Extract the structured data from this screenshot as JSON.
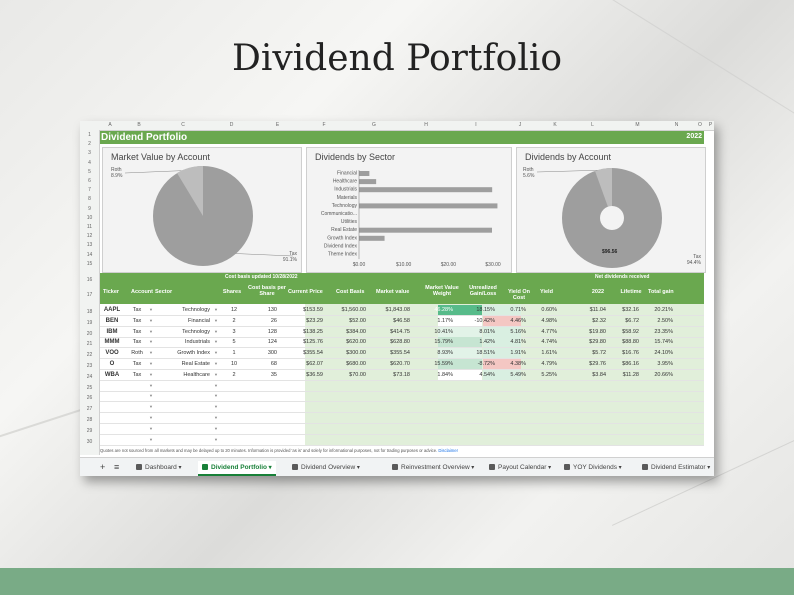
{
  "headline": "Dividend Portfolio",
  "sheet": {
    "col_letters": [
      "A",
      "B",
      "C",
      "D",
      "E",
      "F",
      "G",
      "H",
      "I",
      "J",
      "K",
      "L",
      "M",
      "N",
      "O",
      "P"
    ],
    "row_numbers": [
      "1",
      "2",
      "3",
      "4",
      "5",
      "6",
      "7",
      "8",
      "9",
      "10",
      "11",
      "12",
      "13",
      "14",
      "15",
      "16",
      "17",
      "18",
      "19",
      "20",
      "21",
      "22",
      "23",
      "24",
      "25",
      "26",
      "27",
      "28",
      "29",
      "30"
    ],
    "title": "Dividend Portfolio",
    "year": "2022",
    "charts": {
      "market_value": {
        "title": "Market Value by Account",
        "roth_label": "Roth",
        "roth_pct": "8.9%",
        "tax_label": "Tax",
        "tax_pct": "91.1%"
      },
      "sector": {
        "title": "Dividends by Sector",
        "categories": [
          "Financial",
          "Healthcare",
          "Industrials",
          "Materials",
          "Technology",
          "Communicatio...",
          "Utilities",
          "Real Estate",
          "Growth Index",
          "Dividend Index",
          "Theme Index"
        ],
        "values": [
          2.32,
          3.84,
          29.8,
          0,
          30.98,
          0,
          0,
          29.76,
          5.72,
          0,
          0
        ],
        "ticks": [
          "$0.00",
          "$10.00",
          "$20.00",
          "$30.00"
        ],
        "xlim": [
          0,
          32
        ]
      },
      "account_div": {
        "title": "Dividends by Account",
        "roth_label": "Roth",
        "roth_pct": "5.6%",
        "tax_label": "Tax",
        "tax_pct": "94.4%",
        "center_value": "$96.56"
      }
    },
    "notes": {
      "cost_basis_updated": "Cost basis updated 10/28/2022",
      "net_dividends": "Net dividends received"
    },
    "headers": [
      "Ticker",
      "Account",
      "Sector",
      "Shares",
      "Cost basis per Share",
      "Current Price",
      "Cost Basis",
      "Market value",
      "Market Value Weight",
      "Unrealized Gain/Loss",
      "Yield On Cost",
      "Yield",
      "2022",
      "Lifetime",
      "Total gain"
    ],
    "rows": [
      {
        "ticker": "AAPL",
        "account": "Tax",
        "sector": "Technology",
        "shares": "12",
        "cbps": "130",
        "price": "$153.59",
        "cost": "$1,560.00",
        "mv": "$1,843.08",
        "weight": "46.28%",
        "ugl": "18.15%",
        "yoc": "0.71%",
        "yield": "0.60%",
        "y2022": "$11.04",
        "lifetime": "$32.16",
        "total": "20.21%"
      },
      {
        "ticker": "BEN",
        "account": "Tax",
        "sector": "Financial",
        "shares": "2",
        "cbps": "26",
        "price": "$23.29",
        "cost": "$52.00",
        "mv": "$46.58",
        "weight": "1.17%",
        "ugl": "-10.42%",
        "yoc": "4.46%",
        "yield": "4.98%",
        "y2022": "$2.32",
        "lifetime": "$6.72",
        "total": "2.50%"
      },
      {
        "ticker": "IBM",
        "account": "Tax",
        "sector": "Technology",
        "shares": "3",
        "cbps": "128",
        "price": "$138.25",
        "cost": "$384.00",
        "mv": "$414.75",
        "weight": "10.41%",
        "ugl": "8.01%",
        "yoc": "5.16%",
        "yield": "4.77%",
        "y2022": "$19.80",
        "lifetime": "$58.92",
        "total": "23.35%"
      },
      {
        "ticker": "MMM",
        "account": "Tax",
        "sector": "Industrials",
        "shares": "5",
        "cbps": "124",
        "price": "$125.76",
        "cost": "$620.00",
        "mv": "$628.80",
        "weight": "15.79%",
        "ugl": "1.42%",
        "yoc": "4.81%",
        "yield": "4.74%",
        "y2022": "$29.80",
        "lifetime": "$88.80",
        "total": "15.74%"
      },
      {
        "ticker": "VOO",
        "account": "Roth",
        "sector": "Growth Index",
        "shares": "1",
        "cbps": "300",
        "price": "$355.54",
        "cost": "$300.00",
        "mv": "$355.54",
        "weight": "8.93%",
        "ugl": "18.51%",
        "yoc": "1.91%",
        "yield": "1.61%",
        "y2022": "$5.72",
        "lifetime": "$16.76",
        "total": "24.10%"
      },
      {
        "ticker": "O",
        "account": "Tax",
        "sector": "Real Estate",
        "shares": "10",
        "cbps": "68",
        "price": "$62.07",
        "cost": "$680.00",
        "mv": "$620.70",
        "weight": "15.59%",
        "ugl": "-8.72%",
        "yoc": "4.38%",
        "yield": "4.79%",
        "y2022": "$29.76",
        "lifetime": "$86.16",
        "total": "3.95%"
      },
      {
        "ticker": "WBA",
        "account": "Tax",
        "sector": "Healthcare",
        "shares": "2",
        "cbps": "35",
        "price": "$36.59",
        "cost": "$70.00",
        "mv": "$73.18",
        "weight": "1.84%",
        "ugl": "4.54%",
        "yoc": "5.49%",
        "yield": "5.25%",
        "y2022": "$3.84",
        "lifetime": "$11.28",
        "total": "20.66%"
      }
    ],
    "footer": {
      "text": "Quotes are not sourced from all markets and may be delayed up to 20 minutes. Information is provided 'as is' and solely for informational purposes, not for trading purposes or advice.",
      "link": "Disclaimer"
    },
    "tabs": [
      {
        "label": "Dashboard",
        "active": false
      },
      {
        "label": "Dividend Portfolio",
        "active": true
      },
      {
        "label": "Dividend Overview",
        "active": false
      },
      {
        "label": "Reinvestment Overview",
        "active": false
      },
      {
        "label": "Payout Calendar",
        "active": false
      },
      {
        "label": "YOY Dividends",
        "active": false
      },
      {
        "label": "Dividend Estimator",
        "active": false
      }
    ],
    "tab_add": "+",
    "tab_list": "≡"
  },
  "colors": {
    "green": "#6aa84f",
    "light_green": "#e1efda",
    "strong_green": "#57bb8a",
    "red": "#f4c7c3",
    "pie_gray": "#9e9e9e"
  }
}
